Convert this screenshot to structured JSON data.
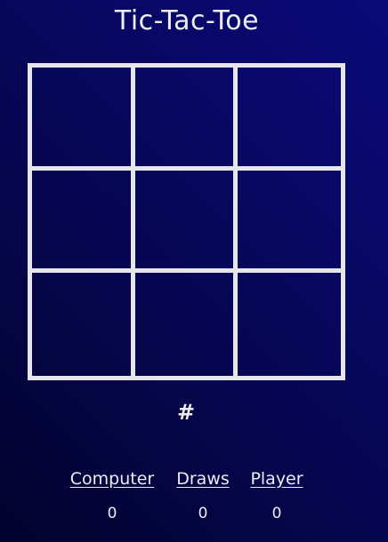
{
  "title": "Tic-Tac-Toe",
  "board": {
    "cells": [
      "",
      "",
      "",
      "",
      "",
      "",
      "",
      "",
      ""
    ]
  },
  "turn_indicator": "#",
  "scores": {
    "computer": {
      "label": "Computer",
      "value": "0"
    },
    "draws": {
      "label": "Draws",
      "value": "0"
    },
    "player": {
      "label": "Player",
      "value": "0"
    }
  }
}
